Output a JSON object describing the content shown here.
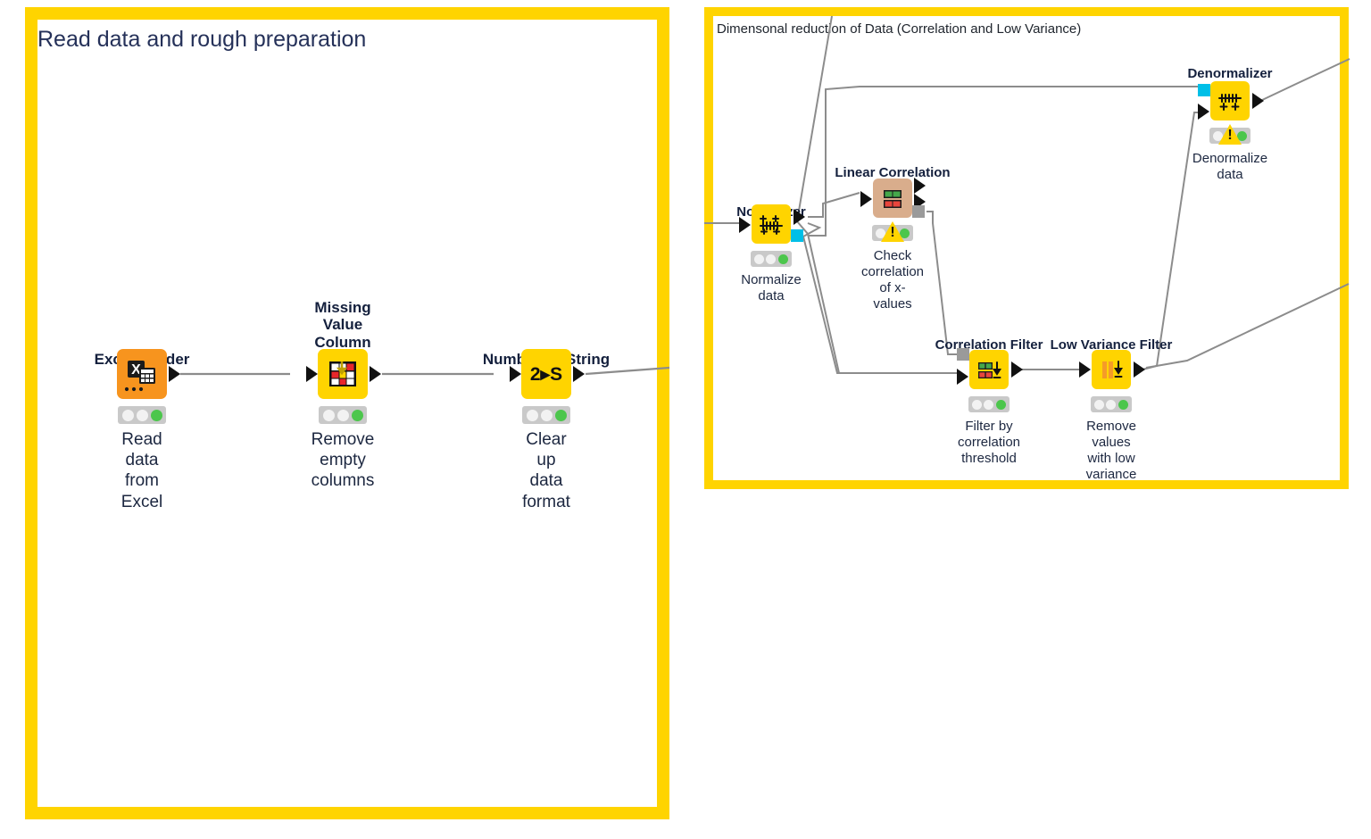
{
  "app": {
    "type": "knime-workflow-canvas",
    "background": "#ffffff",
    "frame_color": "#FFD400"
  },
  "metanodes": [
    {
      "id": "left",
      "title": "Read data and rough preparation",
      "border_color": "#FFD400"
    },
    {
      "id": "right",
      "title": "Dimensonal reduction of Data (Correlation and Low Variance)",
      "border_color": "#FFD400"
    }
  ],
  "nodes": [
    {
      "id": "excel-reader",
      "name": "Excel Reader",
      "icon": "excel-reader-icon",
      "color": "#F7941E",
      "annotation": "Read data\nfrom Excel",
      "status": {
        "lamps": [
          "idle",
          "idle",
          "green"
        ],
        "warning": false
      },
      "ports": {
        "in": 0,
        "out": 1
      }
    },
    {
      "id": "missing-value-column-filter",
      "name": "Missing Value\nColumn Filter",
      "icon": "missing-value-column-filter-icon",
      "color": "#FFD400",
      "annotation": "Remove\nempty\ncolumns",
      "status": {
        "lamps": [
          "idle",
          "idle",
          "green"
        ],
        "warning": false
      },
      "ports": {
        "in": 1,
        "out": 1
      }
    },
    {
      "id": "number-to-string",
      "name": "Number To String",
      "icon": "number-to-string-icon",
      "icon_text": "2▸S",
      "color": "#FFD400",
      "annotation": "Clear up\ndata format",
      "status": {
        "lamps": [
          "idle",
          "idle",
          "green"
        ],
        "warning": false
      },
      "ports": {
        "in": 1,
        "out": 1
      }
    },
    {
      "id": "normalizer",
      "name": "Normalizer",
      "icon": "normalizer-icon",
      "color": "#FFD400",
      "annotation": "Normalize\ndata",
      "status": {
        "lamps": [
          "idle",
          "idle",
          "green"
        ],
        "warning": false
      },
      "ports": {
        "in": 1,
        "out": 2
      }
    },
    {
      "id": "linear-correlation",
      "name": "Linear Correlation",
      "icon": "linear-correlation-icon",
      "color": "#D9AD8C",
      "annotation": "Check\ncorrelation\nof x-values",
      "status": {
        "lamps": [
          "idle",
          "warning",
          "green"
        ],
        "warning": true
      },
      "ports": {
        "in": 1,
        "out": 3
      }
    },
    {
      "id": "denormalizer",
      "name": "Denormalizer",
      "icon": "denormalizer-icon",
      "color": "#FFD400",
      "annotation": "Denormalize\ndata",
      "status": {
        "lamps": [
          "idle",
          "warning",
          "green"
        ],
        "warning": true
      },
      "ports": {
        "in": 2,
        "out": 1
      }
    },
    {
      "id": "correlation-filter",
      "name": "Correlation Filter",
      "icon": "correlation-filter-icon",
      "color": "#FFD400",
      "annotation": "Filter by\ncorrelation\nthreshold",
      "status": {
        "lamps": [
          "idle",
          "idle",
          "green"
        ],
        "warning": false
      },
      "ports": {
        "in": 2,
        "out": 1
      }
    },
    {
      "id": "low-variance-filter",
      "name": "Low Variance Filter",
      "icon": "low-variance-filter-icon",
      "color": "#FFD400",
      "annotation": "Remove values\nwith low\nvariance",
      "status": {
        "lamps": [
          "idle",
          "idle",
          "green"
        ],
        "warning": false
      },
      "ports": {
        "in": 1,
        "out": 1
      }
    }
  ],
  "colors": {
    "frame_yellow": "#FFD400",
    "node_yellow": "#FFD400",
    "node_orange": "#F7941E",
    "node_tan": "#D9AD8C",
    "port_cyan": "#00BFE7",
    "port_gray": "#9a9a9a",
    "lamp_green": "#4CC64C",
    "lamp_idle": "#F2F2F2",
    "status_bg": "#C9C9C9",
    "wire": "#888888",
    "text": "#1c2740"
  }
}
